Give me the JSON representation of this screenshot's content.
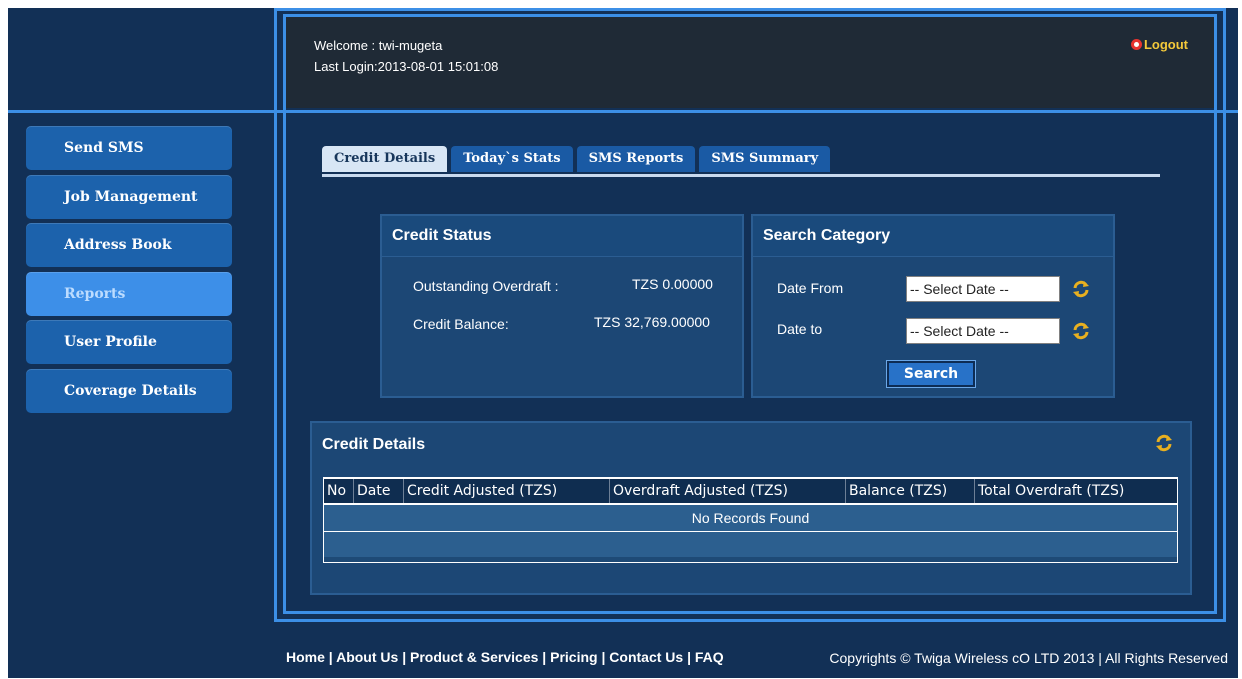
{
  "header": {
    "welcome": "Welcome : twi-mugeta",
    "last_login": "Last Login:2013-08-01 15:01:08",
    "logout_label": "Logout"
  },
  "sidebar": {
    "items": [
      {
        "label": "Send SMS",
        "active": false
      },
      {
        "label": "Job Management",
        "active": false
      },
      {
        "label": "Address Book",
        "active": false
      },
      {
        "label": "Reports",
        "active": true
      },
      {
        "label": "User Profile",
        "active": false
      },
      {
        "label": "Coverage Details",
        "active": false
      }
    ]
  },
  "tabs": [
    {
      "label": "Credit Details",
      "active": true
    },
    {
      "label": "Today`s Stats",
      "active": false
    },
    {
      "label": "SMS Reports",
      "active": false
    },
    {
      "label": "SMS Summary",
      "active": false
    }
  ],
  "credit_status": {
    "title": "Credit Status",
    "outstanding_label": "Outstanding Overdraft :",
    "outstanding_value": "TZS 0.00000",
    "balance_label": "Credit Balance:",
    "balance_value": "TZS 32,769.00000"
  },
  "search_category": {
    "title": "Search Category",
    "date_from_label": "Date From",
    "date_to_label": "Date to",
    "date_from_value": "-- Select Date --",
    "date_to_value": "-- Select Date --",
    "search_label": "Search"
  },
  "credit_details": {
    "title": "Credit Details",
    "columns": [
      "No",
      "Date",
      "Credit Adjusted (TZS)",
      "Overdraft Adjusted (TZS)",
      "Balance (TZS)",
      "Total Overdraft (TZS)"
    ],
    "empty_message": "No Records Found"
  },
  "footer": {
    "links": [
      "Home",
      "About Us",
      "Product & Services",
      "Pricing",
      "Contact Us",
      "FAQ"
    ],
    "separator": " | ",
    "copyright": "Copyrights © Twiga Wireless cO LTD 2013 | All Rights Reserved"
  },
  "colors": {
    "background": "#123056",
    "frame_border": "#3c8fe6",
    "header_bg": "#1f2a36",
    "accent_logout": "#f4c93a"
  }
}
